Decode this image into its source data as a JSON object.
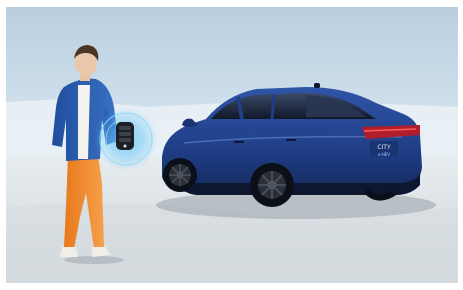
{
  "scene": {
    "car_badge": "CITY",
    "car_badge_sub": "e:HEV"
  },
  "colors": {
    "sky_top": "#c9dbe9",
    "sky_bottom": "#e9f2f8",
    "ground": "#dfe3e6",
    "car_body": "#1f3e86",
    "jacket": "#2d5fb0",
    "pants": "#f28c28",
    "key_glow": "#5fc2f5"
  },
  "icons": {
    "key_fob": "smart-key-icon"
  }
}
